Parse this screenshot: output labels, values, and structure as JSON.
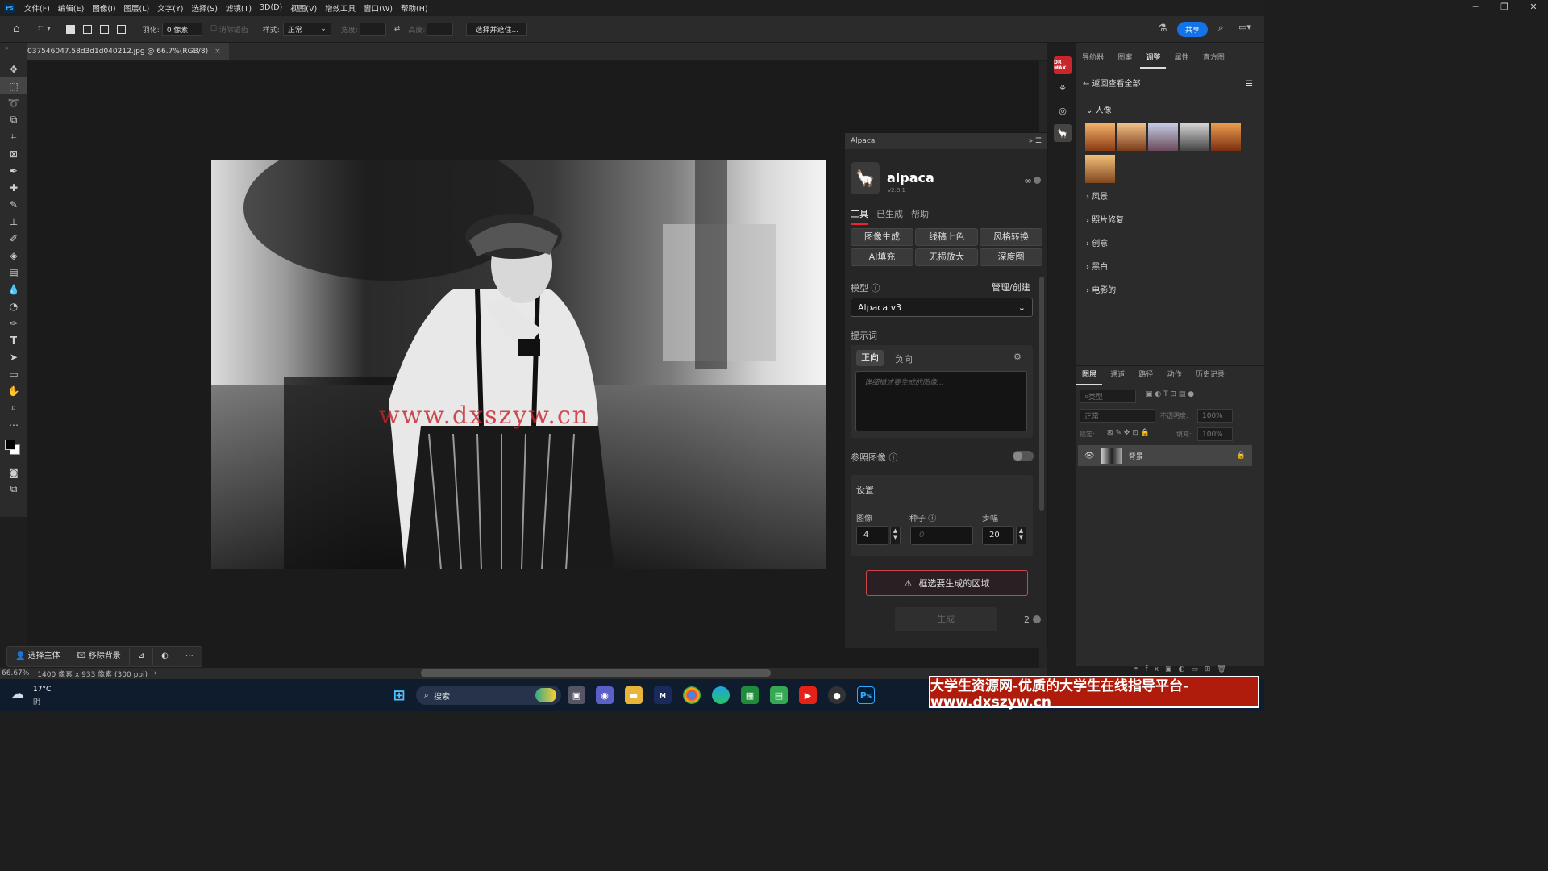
{
  "menubar": {
    "items": [
      "文件(F)",
      "编辑(E)",
      "图像(I)",
      "图层(L)",
      "文字(Y)",
      "选择(S)",
      "滤镜(T)",
      "3D(D)",
      "视图(V)",
      "增效工具",
      "窗口(W)",
      "帮助(H)"
    ],
    "logo": "Ps"
  },
  "window_controls": {
    "minimize": "─",
    "maximize": "❐",
    "close": "✕"
  },
  "options": {
    "feather_label": "羽化:",
    "feather_value": "0 像素",
    "antialias": "消除锯齿",
    "style_label": "样式:",
    "style_value": "正常",
    "width_label": "宽度:",
    "height_label": "高度:",
    "select_mask": "选择并遮住...",
    "share": "共享"
  },
  "document": {
    "tab": "037546047.58d3d1d040212.jpg @ 66.7%(RGB/8)",
    "close": "×",
    "watermark": "www.dxszyw.cn"
  },
  "contextbar": {
    "select_subject": "选择主体",
    "remove_bg": "移除背景",
    "more": "⋯"
  },
  "status": {
    "zoom": "66.67%",
    "info": "1400 像素 x 933 像素 (300 ppi)"
  },
  "alpaca": {
    "panel_title": "Alpaca",
    "name": "alpaca",
    "version": "v2.8.1",
    "tabs": [
      "工具",
      "已生成",
      "帮助"
    ],
    "tools": [
      "图像生成",
      "线稿上色",
      "风格转换",
      "AI填充",
      "无损放大",
      "深度图"
    ],
    "model_label": "模型",
    "manage": "管理/创建",
    "model_value": "Alpaca v3",
    "prompt_label": "提示词",
    "positive": "正向",
    "negative": "负向",
    "prompt_placeholder": "详细描述要生成的图像...",
    "ref_label": "参照图像",
    "settings_label": "设置",
    "images_label": "图像",
    "seed_label": "种子",
    "steps_label": "步幅",
    "images_value": "4",
    "seed_placeholder": "0",
    "steps_value": "20",
    "warn_button": "框选要生成的区域",
    "generate_button": "生成",
    "count": "2",
    "infinity": "∞"
  },
  "adjust_panel": {
    "tabs": [
      "导航器",
      "图案",
      "调整",
      "属性",
      "直方图"
    ],
    "active_tab": "调整",
    "back": "返回查看全部",
    "sections": [
      "人像",
      "风景",
      "照片修复",
      "创意",
      "黑白",
      "电影的"
    ]
  },
  "layers_panel": {
    "tabs": [
      "图层",
      "通道",
      "路径",
      "动作",
      "历史记录"
    ],
    "search_placeholder": "类型",
    "blend": "正常",
    "opacity_label": "不透明度:",
    "opacity": "100%",
    "lock_label": "锁定:",
    "fill_label": "填充:",
    "fill": "100%",
    "layer_name": "背景"
  },
  "taskbar": {
    "temperature": "17°C",
    "weather": "阴",
    "search": "搜索"
  },
  "banner": {
    "text": "大学生资源网-优质的大学生在线指导平台-www.dxszyw.cn"
  }
}
